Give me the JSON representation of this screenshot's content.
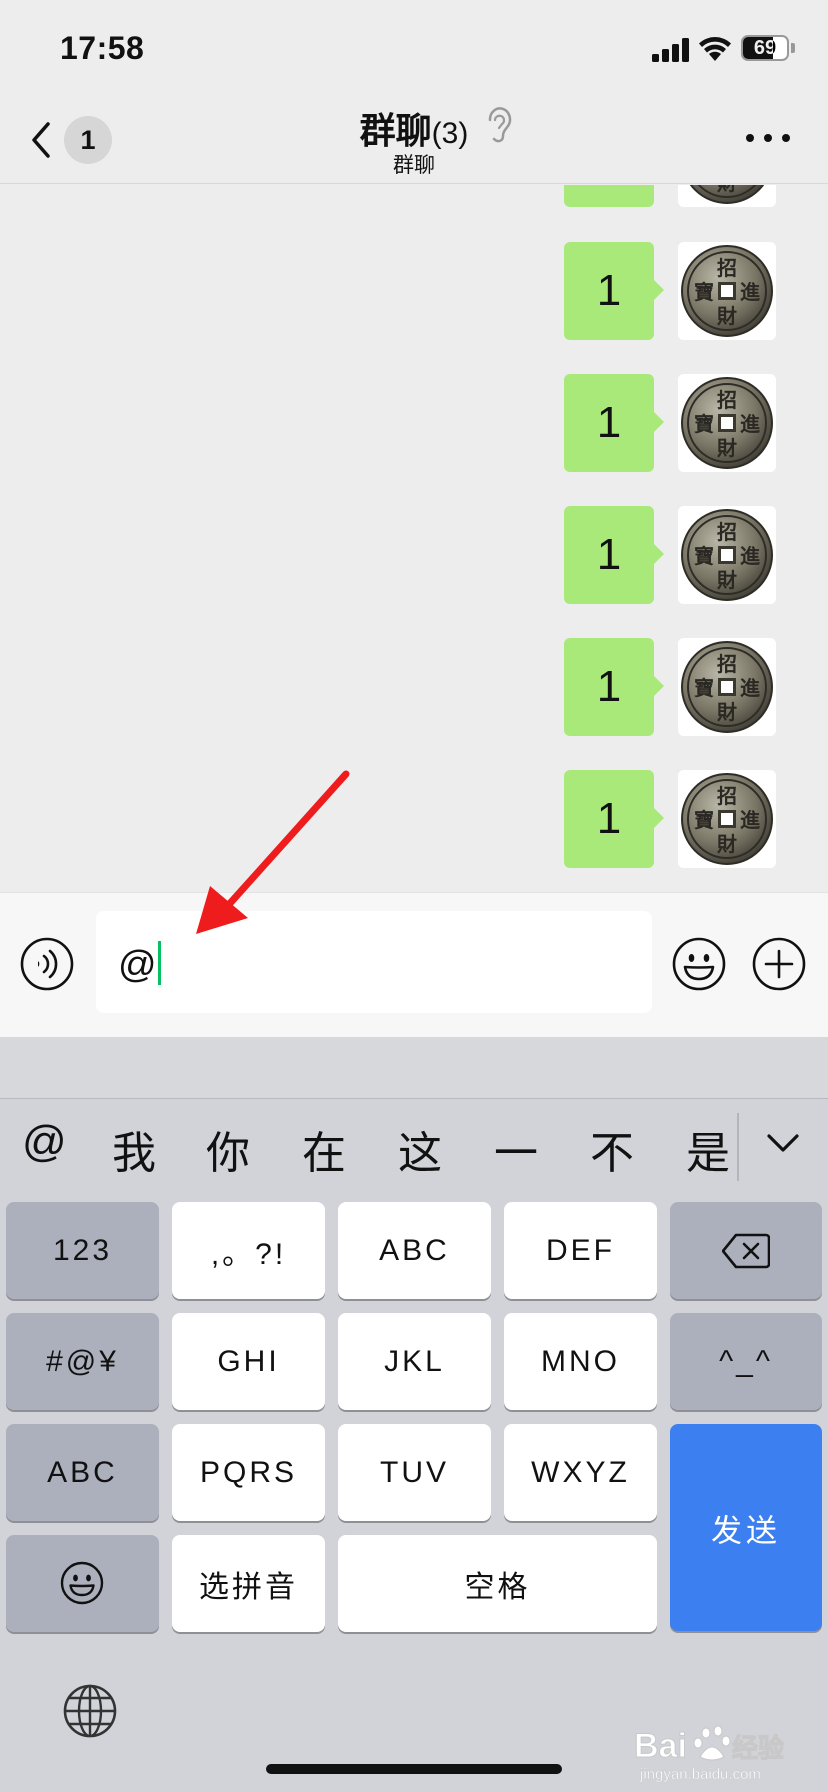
{
  "status_bar": {
    "time": "17:58",
    "battery": "69"
  },
  "nav": {
    "back_count": "1",
    "title": "群聊",
    "member_count": "(3)",
    "subtitle": "群聊"
  },
  "messages": [
    {
      "text": "1",
      "avatar": "coin-avatar"
    },
    {
      "text": "1",
      "avatar": "coin-avatar"
    },
    {
      "text": "1",
      "avatar": "coin-avatar"
    },
    {
      "text": "1",
      "avatar": "coin-avatar"
    },
    {
      "text": "1",
      "avatar": "coin-avatar"
    },
    {
      "text": "1",
      "avatar": "coin-avatar"
    }
  ],
  "coin": {
    "top": "招",
    "right": "進",
    "bottom": "財",
    "left": "寶"
  },
  "input": {
    "value": "@"
  },
  "keyboard": {
    "candidates": [
      "@",
      "我",
      "你",
      "在",
      "这",
      "一",
      "不",
      "是"
    ],
    "keys": {
      "num": "123",
      "punct": ",。?!",
      "abc": "ABC",
      "def": "DEF",
      "symbols": "#@¥",
      "ghi": "GHI",
      "jkl": "JKL",
      "mno": "MNO",
      "kaomoji": "^_^",
      "abc_switch": "ABC",
      "pqrs": "PQRS",
      "tuv": "TUV",
      "wxyz": "WXYZ",
      "send": "发送",
      "pinyin": "选拼音",
      "space": "空格"
    }
  },
  "watermark": {
    "text": "Bai 经验",
    "url": "jingyan.baidu.com"
  },
  "colors": {
    "bubble": "#a9e97a",
    "send_key": "#3b7ff0",
    "cursor": "#07c160",
    "arrow": "#ee1c1c"
  }
}
